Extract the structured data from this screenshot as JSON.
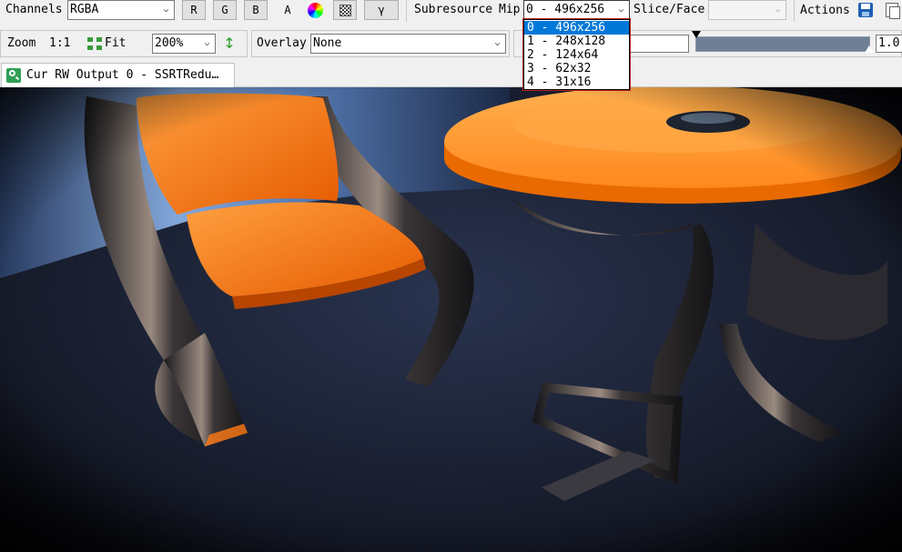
{
  "toolbar1": {
    "channels_label": "Channels",
    "channels_value": "RGBA",
    "channel_buttons": [
      "R",
      "G",
      "B"
    ],
    "alpha_label": "A",
    "gamma_label": "γ",
    "subresource_label": "Subresource",
    "mip_label": "Mip",
    "mip_value": "0 - 496x256",
    "slice_face_label": "Slice/Face",
    "slice_face_value": "",
    "actions_label": "Actions"
  },
  "toolbar2": {
    "zoom_label": "Zoom",
    "zoom_one_to_one": "1:1",
    "fit_label": "Fit",
    "zoom_value": "200%",
    "overlay_label": "Overlay",
    "overlay_value": "None",
    "range_max": "1.0"
  },
  "mip_dropdown": {
    "options": [
      "0 - 496x256",
      "1 - 248x128",
      "2 - 124x64",
      "3 - 62x32",
      "4 - 31x16"
    ],
    "selected_index": 0
  },
  "tab": {
    "title": "Cur RW Output 0 - SSRTRedu…"
  },
  "colors": {
    "toolbar_bg": "#f0f0f0",
    "selection": "#0078d7",
    "accent_orange": "#ff7a14",
    "scene_floor": "#1c2233"
  }
}
